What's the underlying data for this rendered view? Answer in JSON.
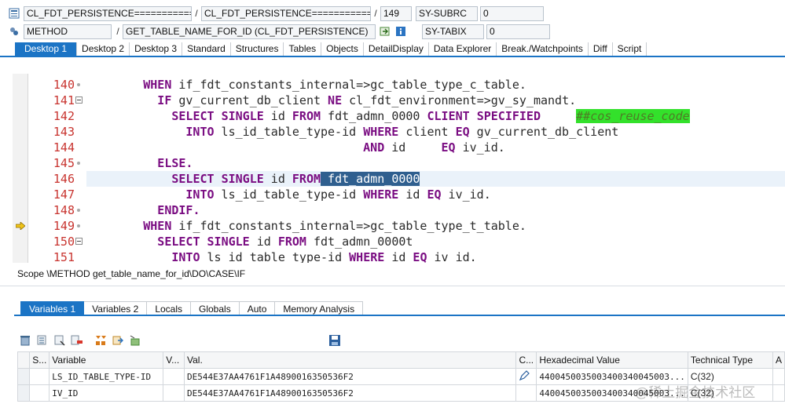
{
  "header": {
    "row1": {
      "program": "CL_FDT_PERSISTENCE===========...",
      "include": "CL_FDT_PERSISTENCE============...",
      "line_number": "149",
      "sysfield_name": "SY-SUBRC",
      "sysfield_value": "0"
    },
    "row2": {
      "event_type": "METHOD",
      "event_name": "GET_TABLE_NAME_FOR_ID (CL_FDT_PERSISTENCE)",
      "sysfield_name": "SY-TABIX",
      "sysfield_value": "0"
    }
  },
  "desktop_tabs": [
    {
      "label": "Desktop 1",
      "active": true
    },
    {
      "label": "Desktop 2",
      "active": false
    },
    {
      "label": "Desktop 3",
      "active": false
    },
    {
      "label": "Standard",
      "active": false
    },
    {
      "label": "Structures",
      "active": false
    },
    {
      "label": "Tables",
      "active": false
    },
    {
      "label": "Objects",
      "active": false
    },
    {
      "label": "DetailDisplay",
      "active": false
    },
    {
      "label": "Data Explorer",
      "active": false
    },
    {
      "label": "Break./Watchpoints",
      "active": false
    },
    {
      "label": "Diff",
      "active": false
    },
    {
      "label": "Script",
      "active": false
    }
  ],
  "code": {
    "current_line": "149",
    "lines": [
      {
        "n": "140",
        "fold": "dot",
        "indent": 8,
        "tokens": [
          [
            "kw",
            "WHEN"
          ],
          [
            "t",
            " if_fdt_constants_internal=>gc_table_type_c_table."
          ]
        ]
      },
      {
        "n": "141",
        "fold": "box",
        "indent": 10,
        "tokens": [
          [
            "kw",
            "IF"
          ],
          [
            "t",
            " gv_current_db_client "
          ],
          [
            "kw",
            "NE"
          ],
          [
            "t",
            " cl_fdt_environment=>gv_sy_mandt."
          ]
        ]
      },
      {
        "n": "142",
        "fold": "",
        "indent": 12,
        "tokens": [
          [
            "kw",
            "SELECT SINGLE"
          ],
          [
            "t",
            " id "
          ],
          [
            "kw",
            "FROM"
          ],
          [
            "t",
            " fdt_admn_0000 "
          ],
          [
            "kw",
            "CLIENT SPECIFIED"
          ],
          [
            "t",
            "     "
          ],
          [
            "cm",
            "##cos_reuse_code"
          ]
        ]
      },
      {
        "n": "143",
        "fold": "",
        "indent": 14,
        "tokens": [
          [
            "kw",
            "INTO"
          ],
          [
            "t",
            " ls_id_table_type-id "
          ],
          [
            "kw",
            "WHERE"
          ],
          [
            "t",
            " client "
          ],
          [
            "kw",
            "EQ"
          ],
          [
            "t",
            " gv_current_db_client"
          ]
        ]
      },
      {
        "n": "144",
        "fold": "",
        "indent": 39,
        "tokens": [
          [
            "kw",
            "AND"
          ],
          [
            "t",
            " id     "
          ],
          [
            "kw",
            "EQ"
          ],
          [
            "t",
            " iv_id."
          ]
        ]
      },
      {
        "n": "145",
        "fold": "dot",
        "indent": 10,
        "tokens": [
          [
            "kw",
            "ELSE."
          ]
        ]
      },
      {
        "n": "146",
        "fold": "",
        "indent": 12,
        "highlight": true,
        "tokens": [
          [
            "kw",
            "SELECT SINGLE"
          ],
          [
            "t",
            " id "
          ],
          [
            "kw",
            "FROM"
          ],
          [
            "sel",
            " fdt_admn_0000"
          ]
        ]
      },
      {
        "n": "147",
        "fold": "",
        "indent": 14,
        "tokens": [
          [
            "kw",
            "INTO"
          ],
          [
            "t",
            " ls_id_table_type-id "
          ],
          [
            "kw",
            "WHERE"
          ],
          [
            "t",
            " id "
          ],
          [
            "kw",
            "EQ"
          ],
          [
            "t",
            " iv_id."
          ]
        ]
      },
      {
        "n": "148",
        "fold": "dot",
        "indent": 10,
        "tokens": [
          [
            "kw",
            "ENDIF."
          ]
        ]
      },
      {
        "n": "149",
        "fold": "dot",
        "indent": 8,
        "current": true,
        "tokens": [
          [
            "kw",
            "WHEN"
          ],
          [
            "t",
            " if_fdt_constants_internal=>gc_table_type_t_table."
          ]
        ]
      },
      {
        "n": "150",
        "fold": "box",
        "indent": 10,
        "tokens": [
          [
            "kw",
            "SELECT SINGLE"
          ],
          [
            "t",
            " id "
          ],
          [
            "kw",
            "FROM"
          ],
          [
            "t",
            " fdt_admn_0000t"
          ]
        ]
      },
      {
        "n": "151",
        "fold": "",
        "indent": 12,
        "tokens": [
          [
            "kw",
            "INTO"
          ],
          [
            "t",
            " ls_id_table_type-id "
          ],
          [
            "kw",
            "WHERE"
          ],
          [
            "t",
            " id "
          ],
          [
            "kw",
            "EQ"
          ],
          [
            "t",
            " iv_id."
          ]
        ]
      }
    ]
  },
  "scope": "Scope \\METHOD get_table_name_for_id\\DO\\CASE\\IF",
  "variable_tabs": [
    {
      "label": "Variables 1",
      "active": true
    },
    {
      "label": "Variables 2",
      "active": false
    },
    {
      "label": "Locals",
      "active": false
    },
    {
      "label": "Globals",
      "active": false
    },
    {
      "label": "Auto",
      "active": false
    },
    {
      "label": "Memory Analysis",
      "active": false
    }
  ],
  "grid": {
    "columns": [
      "S...",
      "Variable",
      "V...",
      "Val.",
      "C...",
      "Hexadecimal Value",
      "Technical Type",
      "A"
    ],
    "rows": [
      {
        "variable": "LS_ID_TABLE_TYPE-ID",
        "value": "DE544E37AA4761F1A4890016350536F2",
        "hex": "4400450035003400340045003...",
        "type": "C(32)"
      },
      {
        "variable": "IV_ID",
        "value": "DE544E37AA4761F1A4890016350536F2",
        "hex": "4400450035003400340045003...",
        "type": "C(32)"
      }
    ]
  },
  "watermark": "@稀土掘金技术社区",
  "icons": [
    "class-icon",
    "method-icon",
    "navigate-icon",
    "info-icon",
    "delete-icon",
    "save-icon"
  ],
  "colors": {
    "accent": "#1b74c5",
    "keyword": "#7a0d82",
    "line_number": "#c8342f",
    "comment_bg": "#33e12b",
    "selection": "#2f5f8f"
  }
}
